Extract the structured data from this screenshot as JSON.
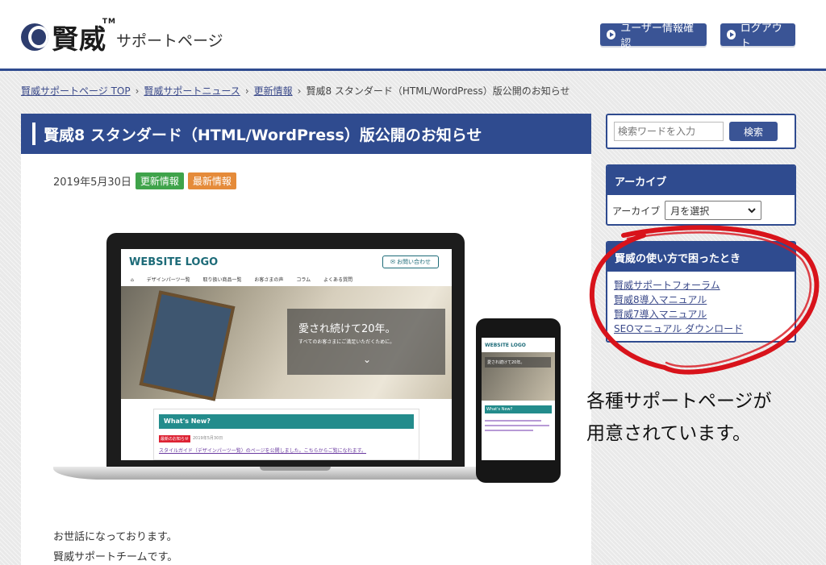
{
  "header": {
    "logo_name": "賢威",
    "logo_tm": "TM",
    "logo_subtitle": "サポートページ",
    "user_button": "ユーザー情報確認",
    "logout_button": "ログアウト"
  },
  "breadcrumb": [
    "賢威サポートページ TOP",
    "賢威サポートニュース",
    "更新情報",
    "賢威8 スタンダード（HTML/WordPress）版公開のお知らせ"
  ],
  "breadcrumb_sep": "›",
  "article": {
    "title": "賢威8 スタンダード（HTML/WordPress）版公開のお知らせ",
    "date": "2019年5月30日",
    "badges": [
      "更新情報",
      "最新情報"
    ],
    "body_lines": [
      "お世話になっております。",
      "賢威サポートチームです。"
    ]
  },
  "mockup": {
    "site_logo": "WEBSITE LOGO",
    "contact": "✉ お問い合わせ",
    "nav": "⌂ デザインパーツ一覧 取り扱い商品一覧 お客さまの声 コラム よくある質問",
    "hero_title": "愛され続けて20年。",
    "hero_sub": "すべてのお客さまにご満足いただくために。",
    "chevron": "⌄",
    "news_title": "What's New?",
    "news_tag": "最新のお知らせ",
    "news_date": "2019年5月30日",
    "news_text": "スタイルガイド（デザインパーツ一覧）のページを公開しました。こちらからご覧になれます。"
  },
  "sidebar": {
    "search_placeholder": "検索ワードを入力",
    "search_button": "検索",
    "archive_title": "アーカイブ",
    "archive_label": "アーカイブ",
    "archive_select": "月を選択",
    "help_title": "賢威の使い方で困ったとき",
    "help_links": [
      "賢威サポートフォーラム",
      "賢威8導入マニュアル",
      "賢威7導入マニュアル",
      "SEOマニュアル ダウンロード"
    ]
  },
  "annotation": {
    "line1": "各種サポートページが",
    "line2": "用意されています。"
  },
  "colors": {
    "brand": "#2f4b8f",
    "badge_green": "#3fa34a",
    "badge_orange": "#e58b3a",
    "annotation_red": "#d8131b"
  }
}
